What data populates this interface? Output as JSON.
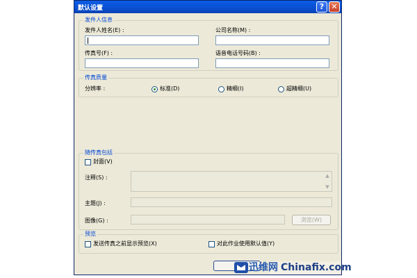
{
  "window": {
    "title": "默认设置",
    "help_glyph": "?",
    "close_glyph": "✕"
  },
  "sender_info": {
    "group_title": "发件人信息",
    "name_label": "发件人姓名(E) :",
    "company_label": "公司名称(M) :",
    "fax_label": "传真号(F) :",
    "voice_label": "语音电话号码(B) :",
    "name_value": "",
    "company_value": "",
    "fax_value": "",
    "voice_value": ""
  },
  "fax_quality": {
    "group_title": "传真质量",
    "resolution_label": "分辨率 :",
    "options": [
      {
        "label": "标准(D)",
        "selected": true
      },
      {
        "label": "精细(I)",
        "selected": false
      },
      {
        "label": "超精细(U)",
        "selected": false
      }
    ]
  },
  "include_with_fax": {
    "group_title": "随传真包括",
    "cover_label": "封面(V)",
    "cover_checked": false,
    "notes_label": "注释(S) :",
    "subject_label": "主题(J) :",
    "image_label": "图像(G) :",
    "browse_label": "浏览(W)",
    "notes_value": "",
    "subject_value": "",
    "image_value": ""
  },
  "preview": {
    "group_title": "预览",
    "show_preview_label": "发送传真之前显示预览(X)",
    "show_preview_checked": false,
    "use_defaults_label": "对此作业使用默认值(Y)",
    "use_defaults_checked": false
  },
  "watermark": {
    "cn": "迅维网",
    "en": "Chinafix.com"
  }
}
